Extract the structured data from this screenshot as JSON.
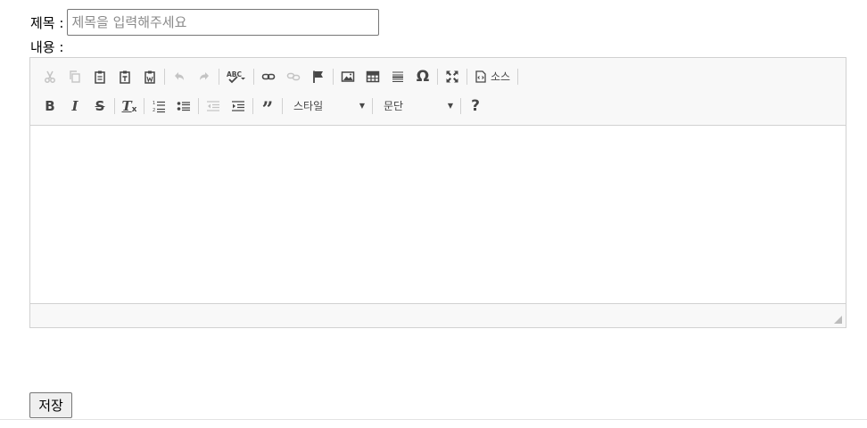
{
  "form": {
    "title_label": "제목 :",
    "title_placeholder": "제목을 입력해주세요",
    "title_value": "",
    "content_label": "내용 :",
    "save_label": "저장"
  },
  "editor": {
    "row1": [
      {
        "name": "cut-icon",
        "glyph": "✂",
        "disabled": true
      },
      {
        "name": "copy-icon",
        "glyph": "⎘",
        "disabled": true
      },
      {
        "name": "paste-icon",
        "glyph": "📋",
        "disabled": false
      },
      {
        "name": "paste-text-icon",
        "glyph": "📋",
        "disabled": false
      },
      {
        "name": "paste-word-icon",
        "glyph": "📋",
        "disabled": false
      },
      {
        "name": "undo-icon",
        "glyph": "↶",
        "disabled": true
      },
      {
        "name": "redo-icon",
        "glyph": "↷",
        "disabled": true
      },
      {
        "name": "spellcheck-icon",
        "glyph": "ABC",
        "disabled": false
      },
      {
        "name": "link-icon",
        "glyph": "🔗",
        "disabled": false
      },
      {
        "name": "unlink-icon",
        "glyph": "⛓",
        "disabled": true
      },
      {
        "name": "anchor-flag-icon",
        "glyph": "⚑",
        "disabled": false
      },
      {
        "name": "image-icon",
        "glyph": "🖼",
        "disabled": false
      },
      {
        "name": "table-icon",
        "glyph": "▦",
        "disabled": false
      },
      {
        "name": "horizontal-line-icon",
        "glyph": "≣",
        "disabled": false
      },
      {
        "name": "special-char-icon",
        "glyph": "Ω",
        "disabled": false
      },
      {
        "name": "maximize-icon",
        "glyph": "⤢",
        "disabled": false
      }
    ],
    "source_label": "소스",
    "style_label": "스타일",
    "format_label": "문단",
    "help_label": "?"
  }
}
